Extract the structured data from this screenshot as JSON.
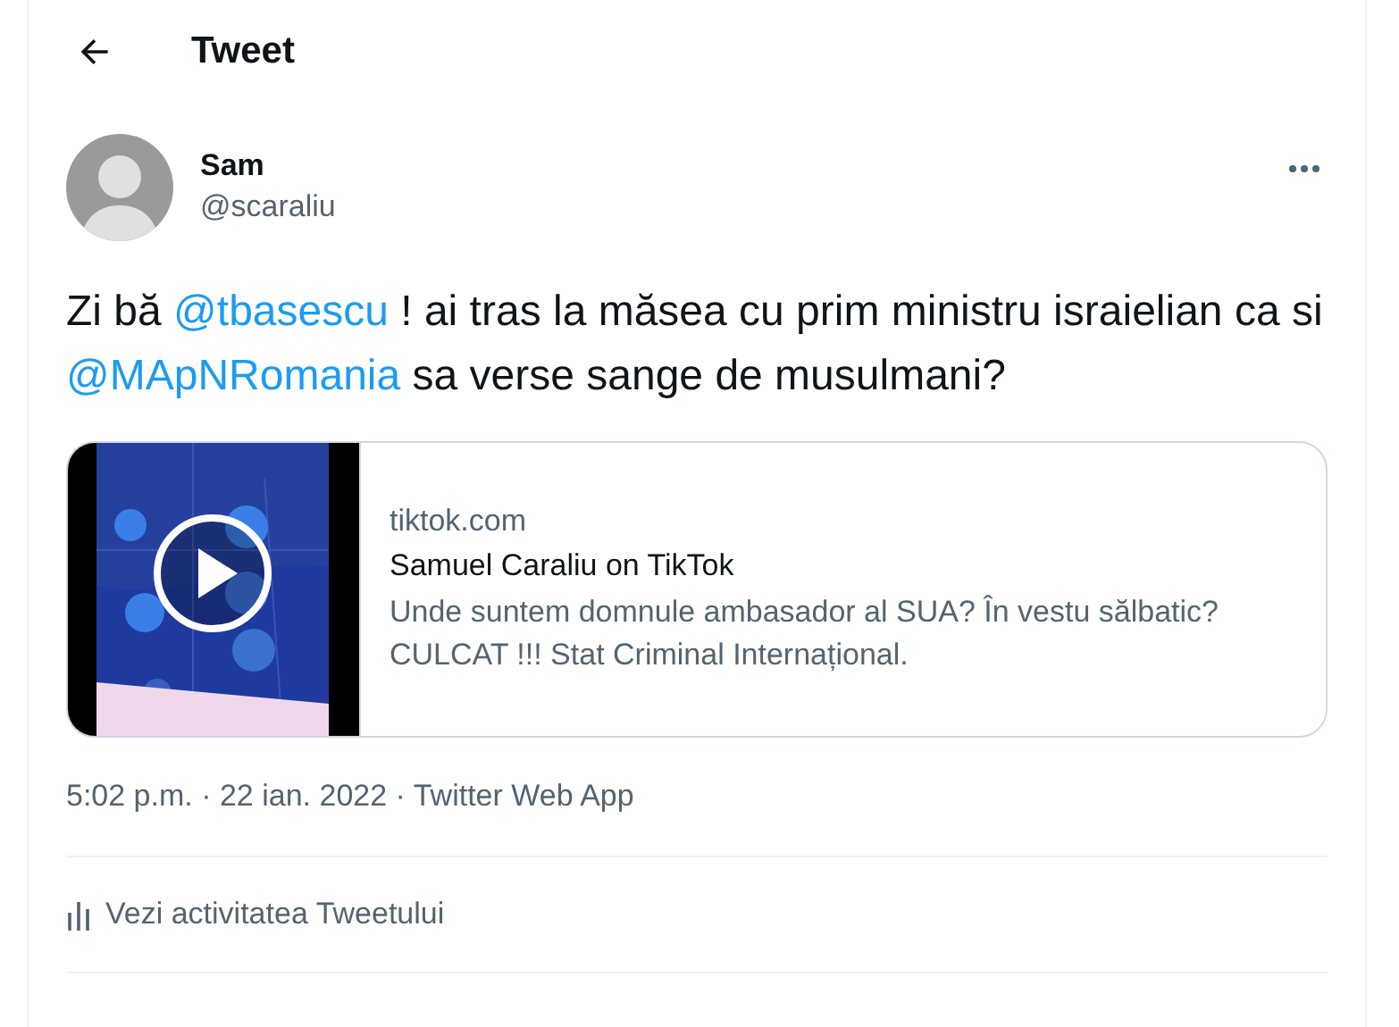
{
  "header": {
    "title": "Tweet"
  },
  "author": {
    "name": "Sam",
    "handle": "@scaraliu"
  },
  "tweet": {
    "segments": [
      {
        "kind": "text",
        "text": "Zi bă "
      },
      {
        "kind": "mention",
        "text": "@tbasescu"
      },
      {
        "kind": "text",
        "text": " ! ai tras la măsea cu prim ministru israielian ca si "
      },
      {
        "kind": "mention",
        "text": "@MApNRomania"
      },
      {
        "kind": "text",
        "text": " sa verse sange de musulmani?"
      }
    ]
  },
  "card": {
    "domain": "tiktok.com",
    "title": "Samuel Caraliu on TikTok",
    "description": "Unde suntem domnule ambasador al SUA? În vestu sălbatic? CULCAT !!! Stat Criminal Internațional."
  },
  "meta": "5:02 p.m. · 22 ian. 2022 · Twitter Web App",
  "activity": {
    "label": "Vezi activitatea Tweetului"
  }
}
